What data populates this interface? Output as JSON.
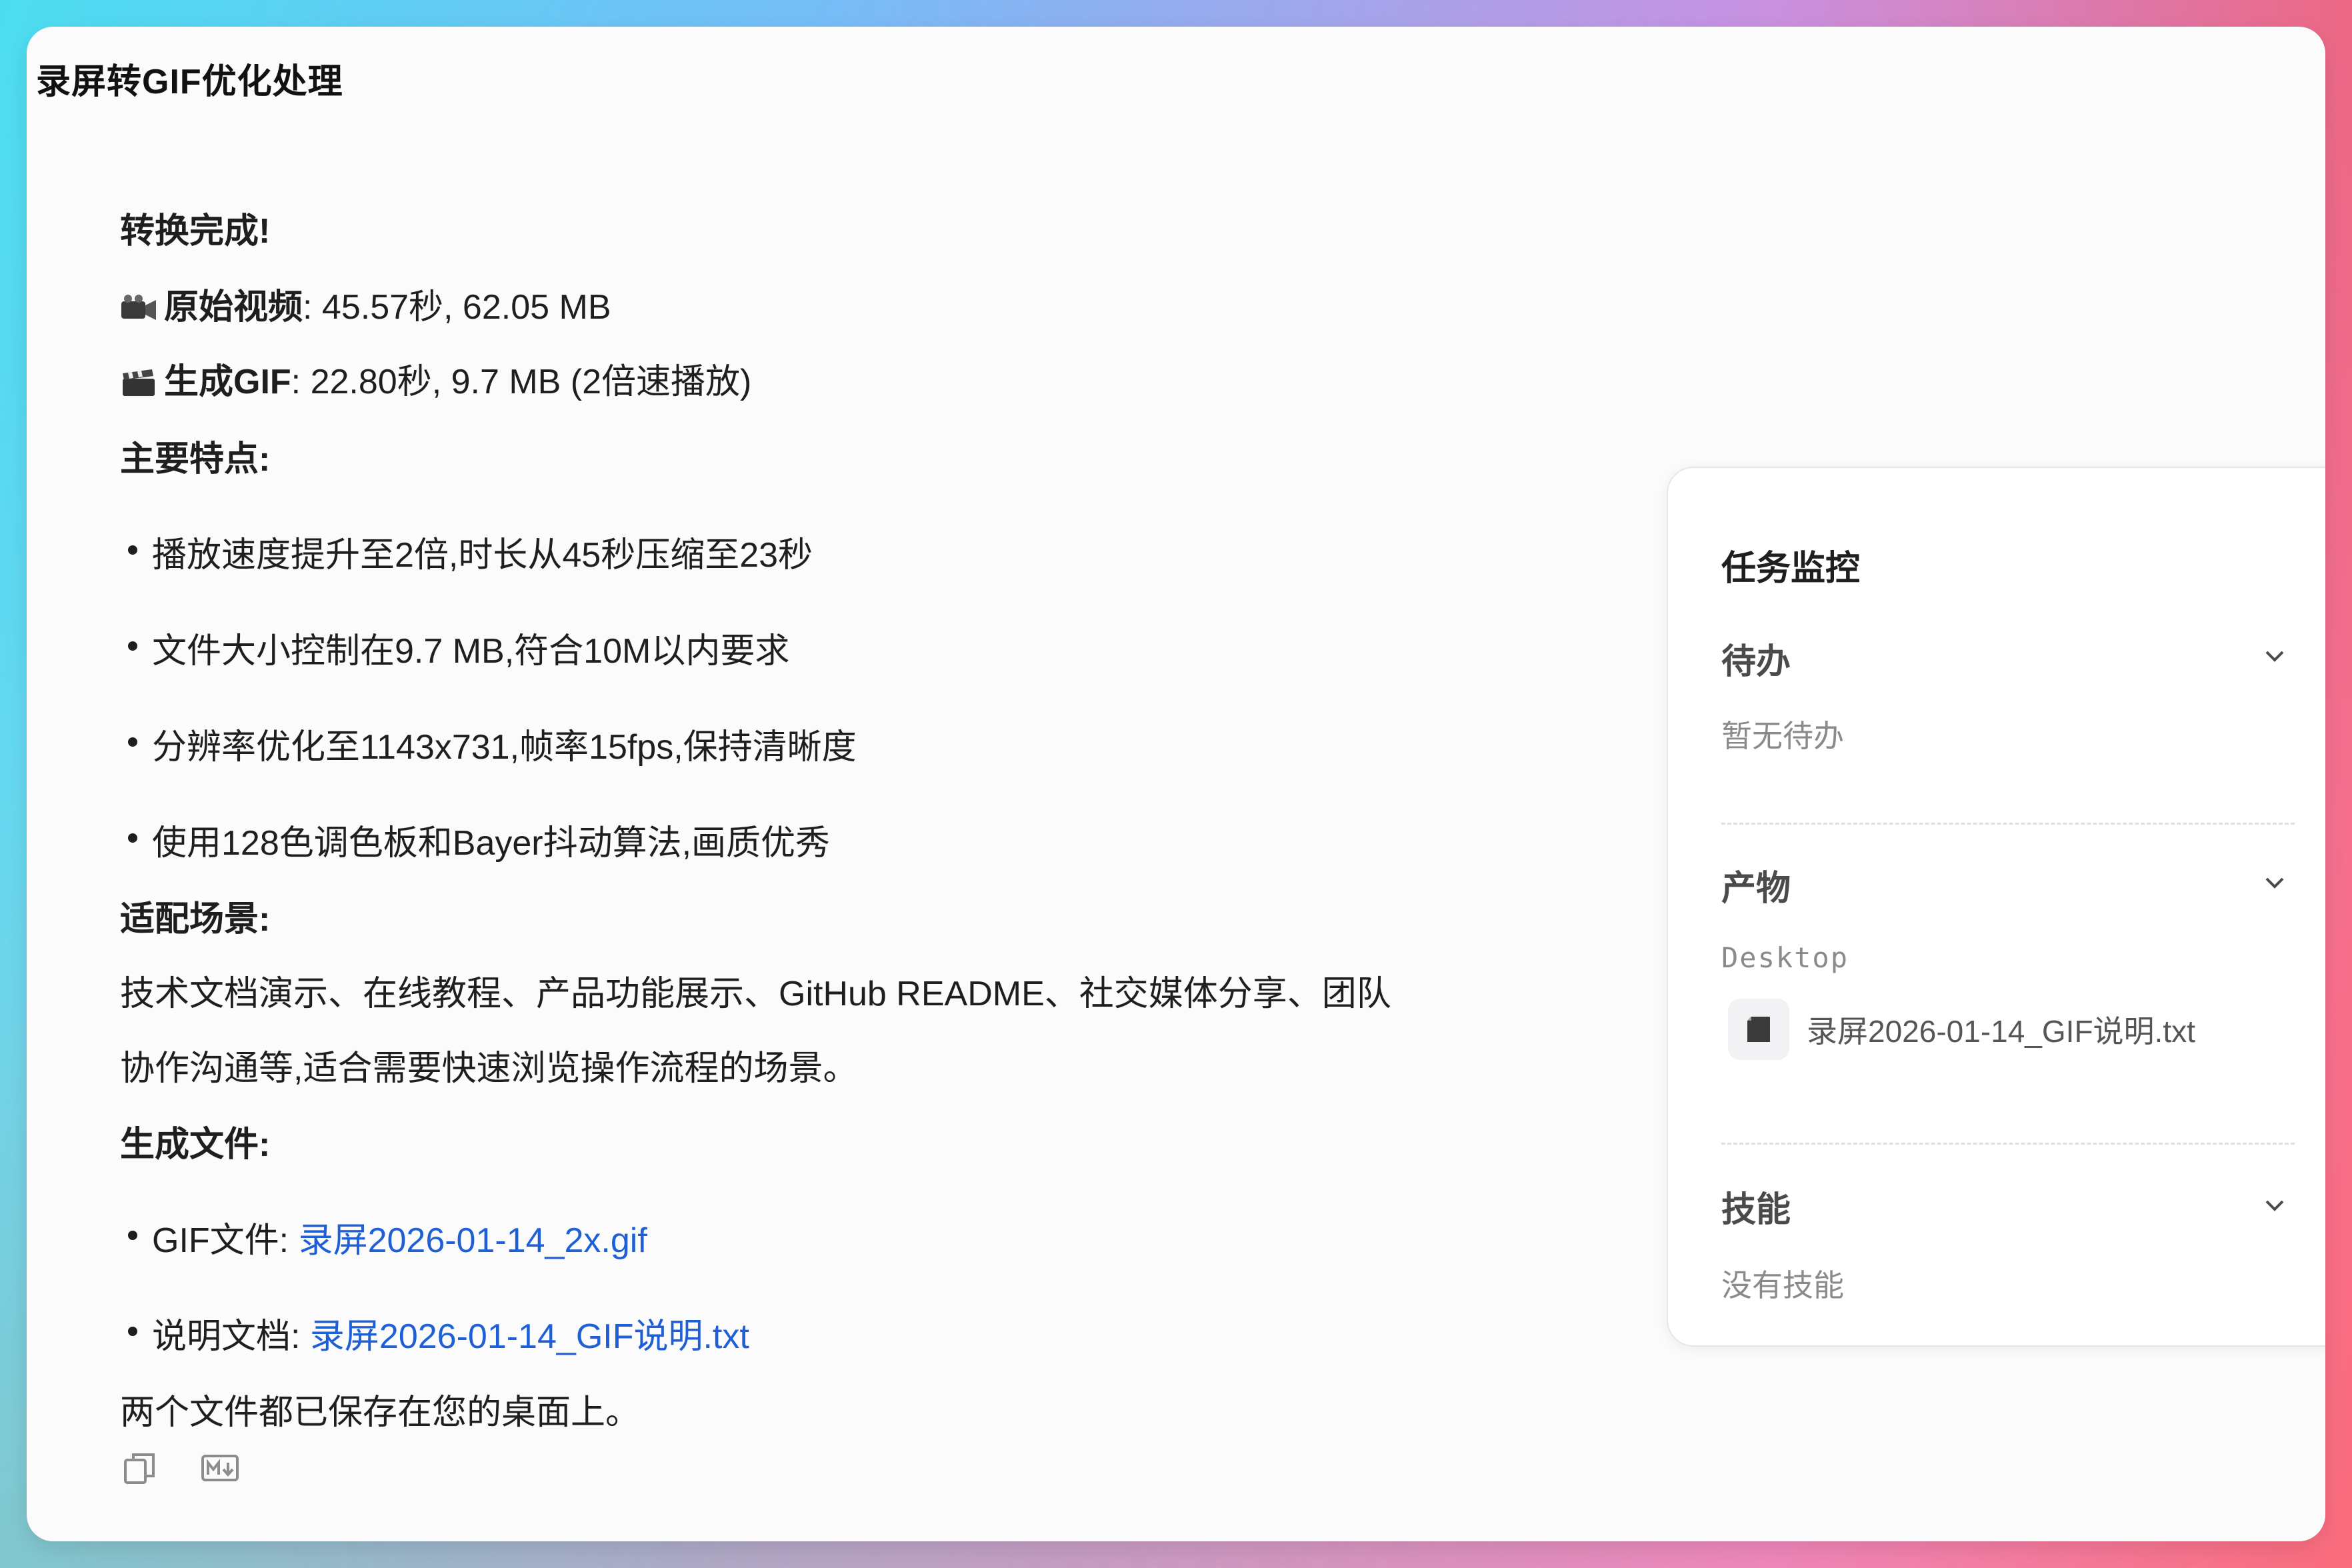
{
  "window": {
    "title": "录屏转GIF优化处理"
  },
  "message": {
    "heading": "转换完成!",
    "original_video_label": "原始视频",
    "original_video_value": ": 45.57秒, 62.05 MB",
    "gif_label": "生成GIF",
    "gif_value": ": 22.80秒, 9.7 MB (2倍速播放)",
    "features_heading": "主要特点:",
    "features": [
      "播放速度提升至2倍,时长从45秒压缩至23秒",
      "文件大小控制在9.7 MB,符合10M以内要求",
      "分辨率优化至1143x731,帧率15fps,保持清晰度",
      "使用128色调色板和Bayer抖动算法,画质优秀"
    ],
    "scenes_heading": "适配场景:",
    "scenes_line1": "技术文档演示、在线教程、产品功能展示、GitHub README、社交媒体分享、团队",
    "scenes_line2": "协作沟通等,适合需要快速浏览操作流程的场景。",
    "files_heading": "生成文件:",
    "files": [
      {
        "label": "GIF文件: ",
        "link": "录屏2026-01-14_2x.gif"
      },
      {
        "label": "说明文档: ",
        "link": "录屏2026-01-14_GIF说明.txt"
      }
    ],
    "footer": "两个文件都已保存在您的桌面上。",
    "actions": {
      "copy_icon": "copy-icon",
      "markdown_icon": "markdown-icon"
    }
  },
  "panel": {
    "title": "任务监控",
    "todo": {
      "title": "待办",
      "empty": "暂无待办"
    },
    "artifacts": {
      "title": "产物",
      "folder": "Desktop",
      "file": "录屏2026-01-14_GIF说明.txt"
    },
    "skills": {
      "title": "技能",
      "empty": "没有技能"
    }
  },
  "colors": {
    "link": "#1f5fd6",
    "window_bg": "#fbfbfc",
    "panel_bg": "#ffffff"
  }
}
